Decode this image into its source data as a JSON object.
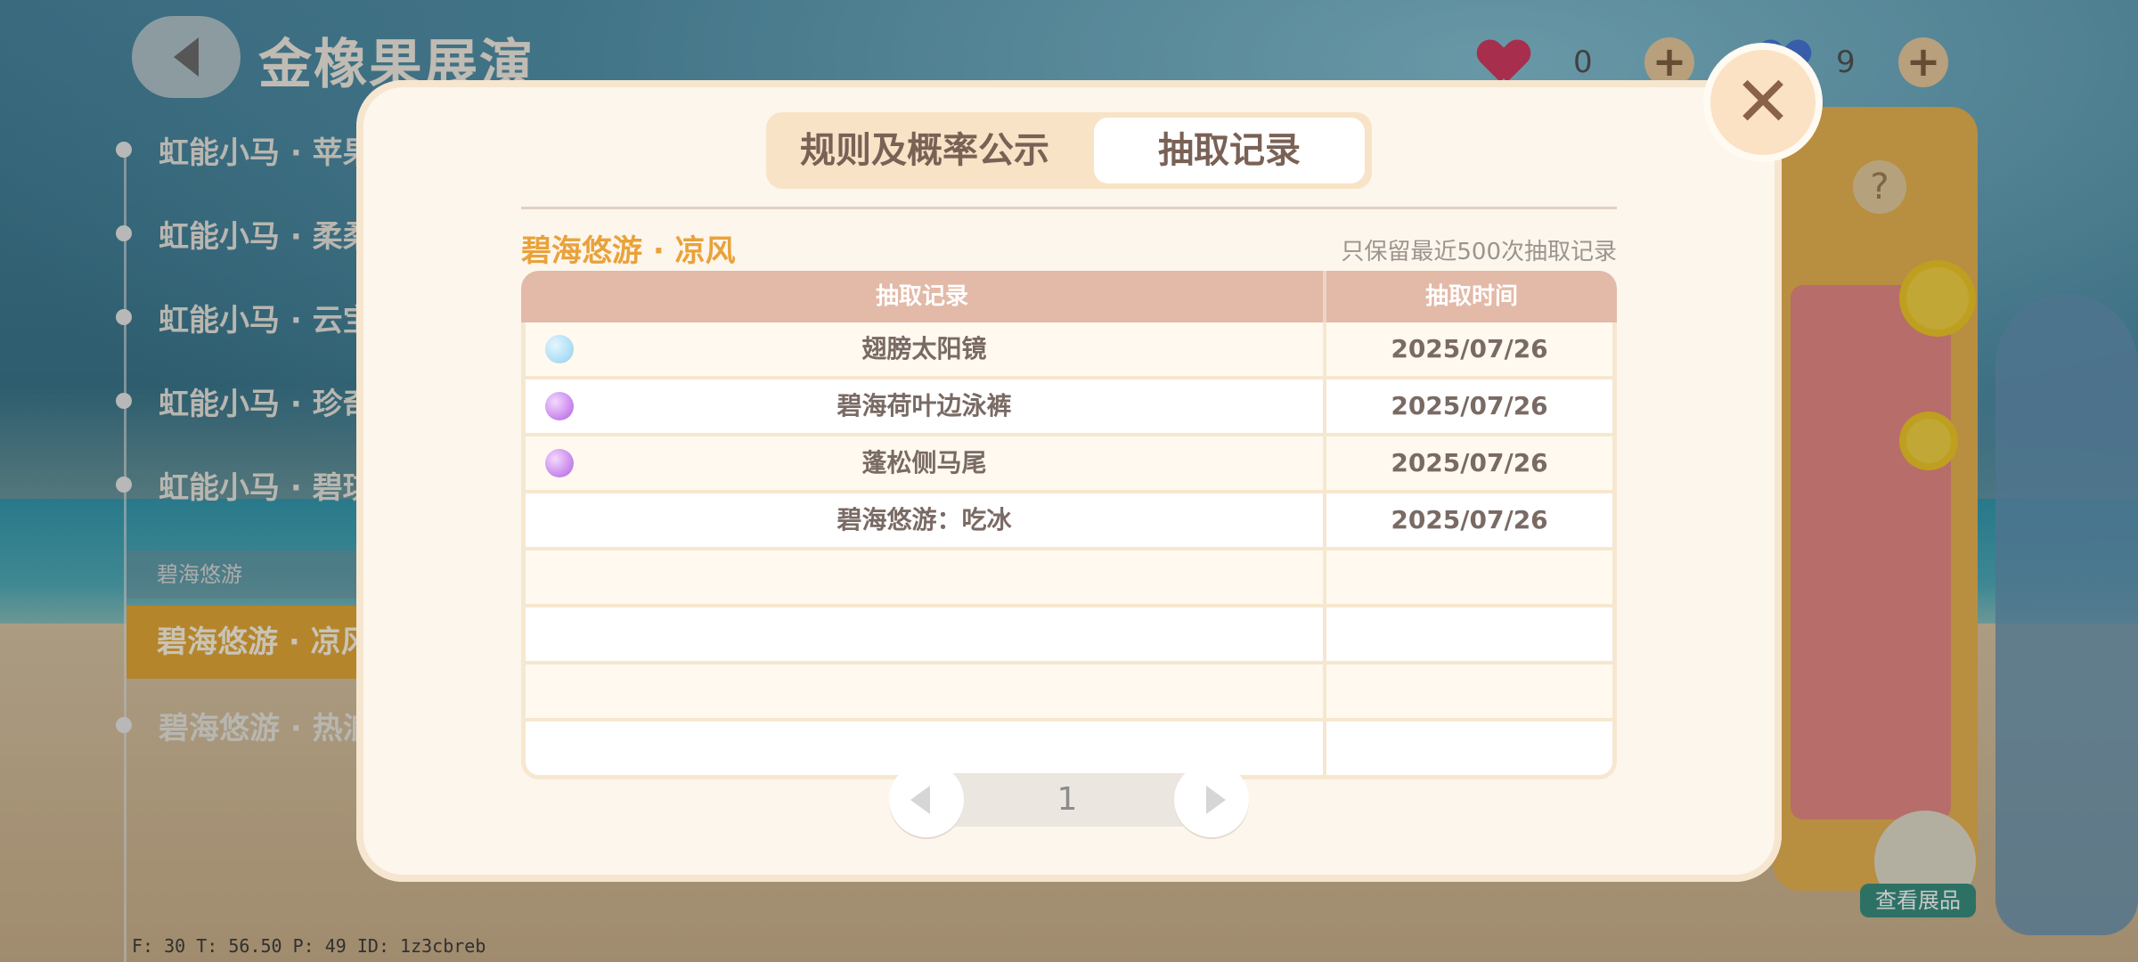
{
  "header": {
    "title": "金橡果展演",
    "currency_red": "0",
    "currency_blue": "9",
    "plus_label": "+"
  },
  "sidebar": {
    "items": [
      {
        "label": "虹能小马 · 苹果"
      },
      {
        "label": "虹能小马 · 柔柔"
      },
      {
        "label": "虹能小马 · 云宝"
      },
      {
        "label": "虹能小马 · 珍奇"
      },
      {
        "label": "虹能小马 · 碧琪"
      }
    ],
    "group_label": "碧海悠游",
    "active_item": "碧海悠游 · 凉风",
    "next_item": "碧海悠游 · 热浪"
  },
  "right": {
    "help_label": "?",
    "view_label": "查看展品"
  },
  "modal": {
    "tabs": [
      "规则及概率公示",
      "抽取记录"
    ],
    "active_tab": "抽取记录",
    "subtitle": "碧海悠游 · 凉风",
    "note": "只保留最近500次抽取记录",
    "table": {
      "headers": [
        "抽取记录",
        "抽取时间"
      ],
      "rows": [
        {
          "item": "翅膀太阳镜",
          "time": "2025/07/26",
          "gem": "blue"
        },
        {
          "item": "碧海荷叶边泳裤",
          "time": "2025/07/26",
          "gem": "purple"
        },
        {
          "item": "蓬松侧马尾",
          "time": "2025/07/26",
          "gem": "purple"
        },
        {
          "item": "碧海悠游：吃冰",
          "time": "2025/07/26",
          "gem": ""
        },
        {
          "item": "",
          "time": "",
          "gem": ""
        },
        {
          "item": "",
          "time": "",
          "gem": ""
        },
        {
          "item": "",
          "time": "",
          "gem": ""
        },
        {
          "item": "",
          "time": "",
          "gem": ""
        }
      ]
    },
    "pager": {
      "page": "1"
    },
    "close_label": "✕"
  },
  "debug": {
    "text": "F: 30    T: 56.50    P: 49    ID: 1z3cbreb"
  },
  "colors": {
    "accent_orange": "#e9a23a",
    "header_row": "#e3b9a7",
    "active_sidebar": "#e3a52c"
  }
}
